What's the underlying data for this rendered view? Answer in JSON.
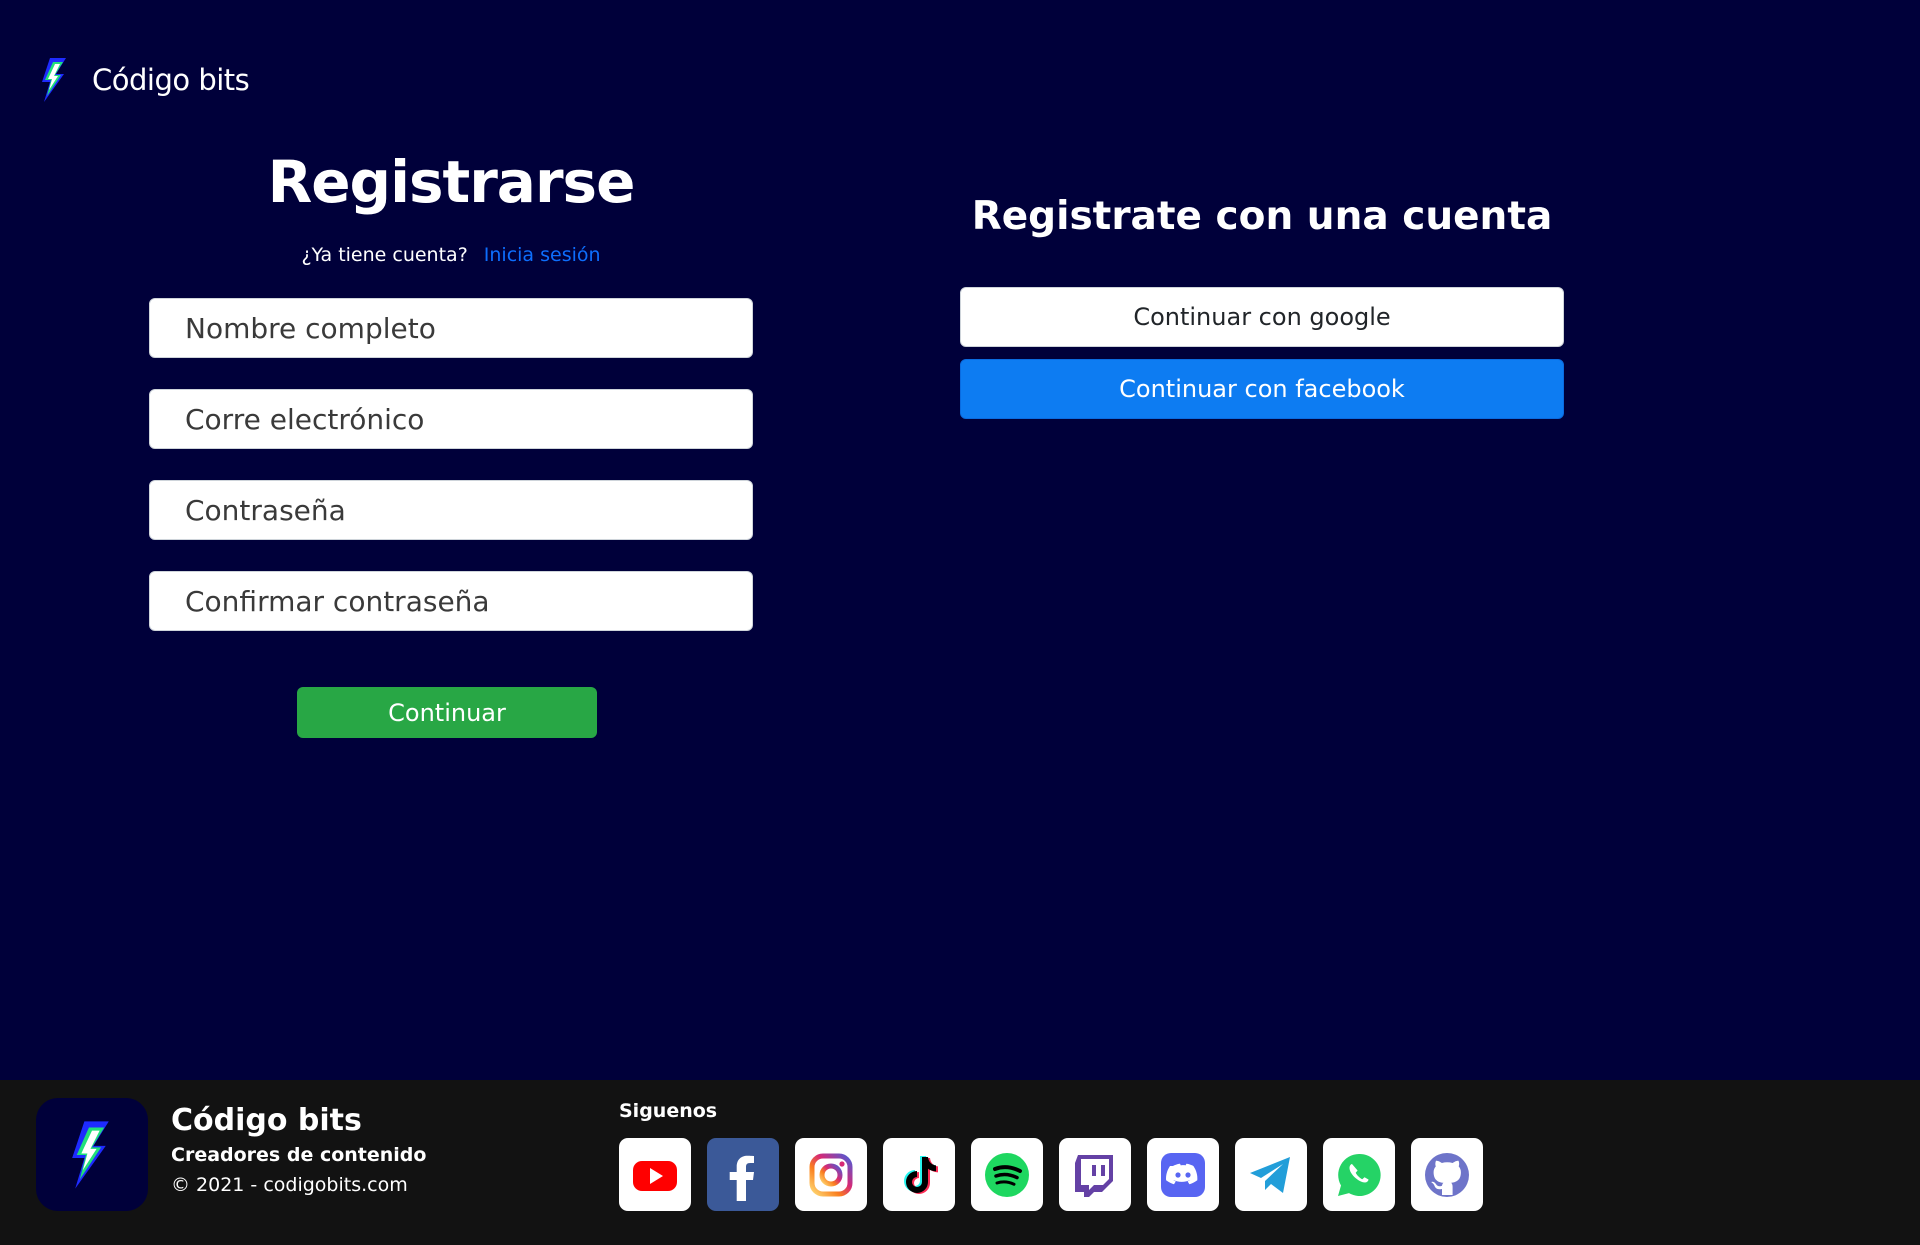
{
  "header": {
    "brand_name": "Código bits",
    "logo_icon": "lightning-bolt-icon"
  },
  "register": {
    "title": "Registrarse",
    "have_account": "¿Ya tiene cuenta?",
    "login_link": "Inicia sesión",
    "fields": [
      {
        "placeholder": "Nombre completo",
        "value": ""
      },
      {
        "placeholder": "Corre electrónico",
        "value": ""
      },
      {
        "placeholder": "Contraseña",
        "value": ""
      },
      {
        "placeholder": "Confirmar contraseña",
        "value": ""
      }
    ],
    "continue_label": "Continuar"
  },
  "social_register": {
    "title": "Registrate con una cuenta",
    "google_label": "Continuar con google",
    "facebook_label": "Continuar con facebook"
  },
  "footer": {
    "brand_name": "Código bits",
    "tagline": "Creadores de contenido",
    "copyright": "© 2021 - codigobits.com",
    "follow_label": "Siguenos",
    "socials": [
      "youtube-icon",
      "facebook-icon",
      "instagram-icon",
      "tiktok-icon",
      "spotify-icon",
      "twitch-icon",
      "discord-icon",
      "telegram-icon",
      "whatsapp-icon",
      "github-icon"
    ]
  },
  "colors": {
    "background": "#00003a",
    "footer_bg": "#121212",
    "continue_green": "#28a745",
    "facebook_blue": "#0d7cf2",
    "link_blue": "#0d6efd"
  }
}
